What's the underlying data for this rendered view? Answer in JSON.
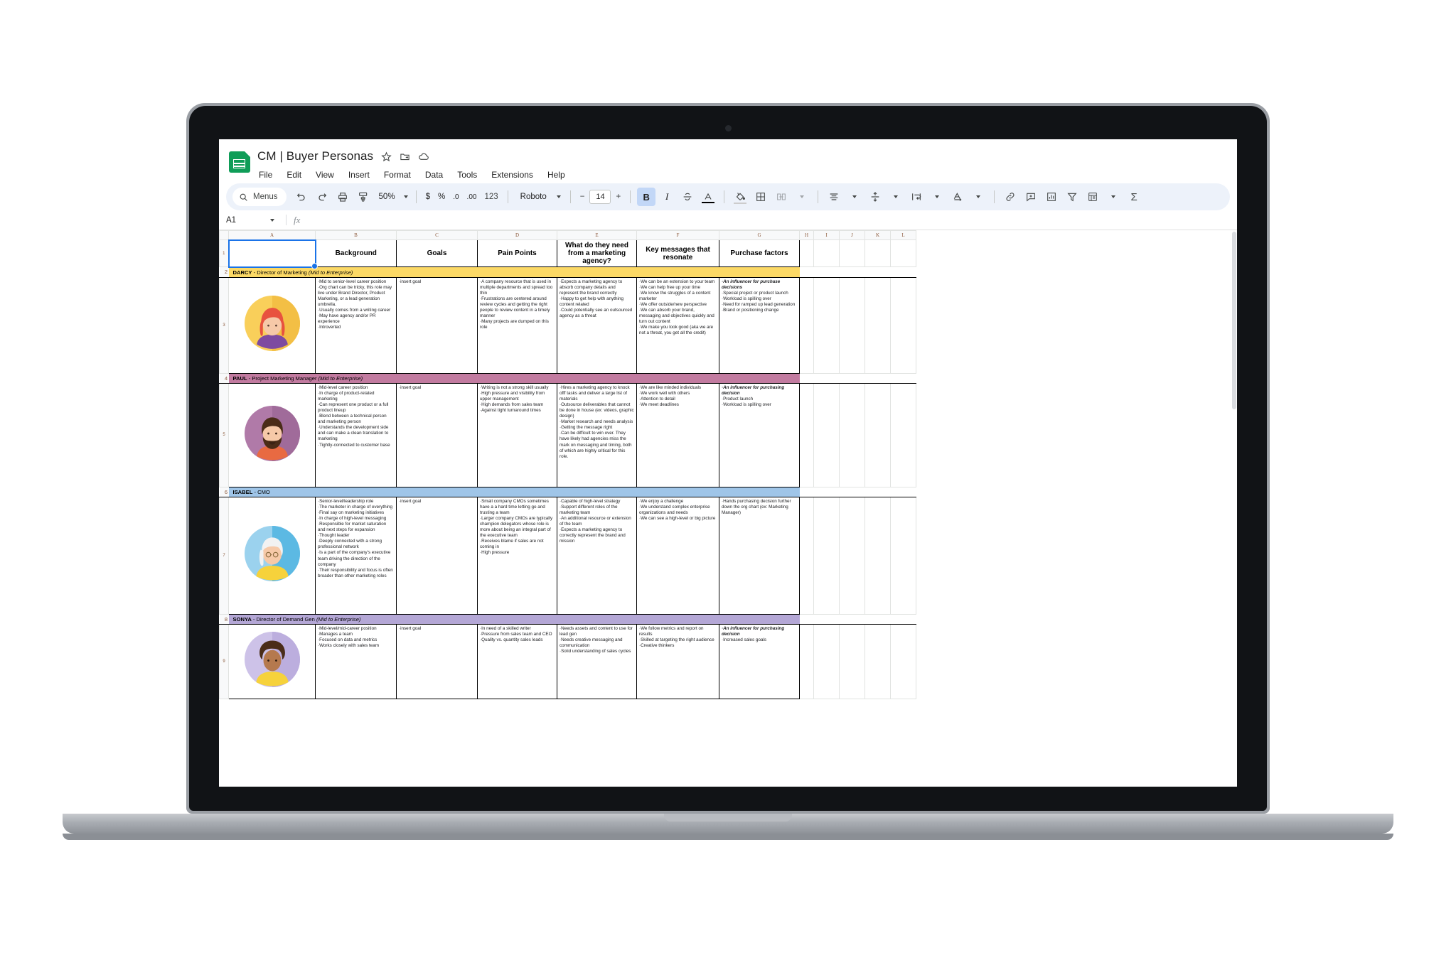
{
  "app": {
    "doc_title": "CM | Buyer Personas",
    "title_icons": [
      "star-icon",
      "move-to-folder-icon",
      "cloud-saved-icon"
    ],
    "menus": [
      "File",
      "Edit",
      "View",
      "Insert",
      "Format",
      "Data",
      "Tools",
      "Extensions",
      "Help"
    ]
  },
  "toolbar": {
    "search_label": "Menus",
    "zoom": "50%",
    "currency": "$",
    "percent": "%",
    "dec_less": ".0",
    "dec_more": ".00",
    "formats": "123",
    "font": "Roboto",
    "font_size": "14",
    "minus": "−",
    "plus": "+",
    "bold": "B",
    "italic": "I",
    "icons": [
      "undo-icon",
      "redo-icon",
      "print-icon",
      "paint-format-icon",
      "strikethrough-icon",
      "text-color-icon",
      "fill-color-icon",
      "borders-icon",
      "merge-cells-icon",
      "horizontal-align-icon",
      "vertical-align-icon",
      "text-wrap-icon",
      "text-rotation-icon",
      "insert-link-icon",
      "insert-comment-icon",
      "insert-chart-icon",
      "filter-icon",
      "functions-icon",
      "sum-icon"
    ]
  },
  "formula_bar": {
    "name_box": "A1",
    "fx_label": "fx",
    "formula_value": ""
  },
  "sheet": {
    "column_letters": [
      "A",
      "B",
      "C",
      "D",
      "E",
      "F",
      "G",
      "H",
      "I",
      "J",
      "K",
      "L"
    ],
    "row_numbers": [
      "1",
      "2",
      "3",
      "4",
      "5",
      "6",
      "7",
      "8",
      "9"
    ],
    "headers": [
      "",
      "Background",
      "Goals",
      "Pain Points",
      "What do they need from a marketing agency?",
      "Key messages that resonate",
      "Purchase factors"
    ],
    "personas": [
      {
        "band_color": "#fcd966",
        "avatar_bg": "#f9cf5a",
        "avatar_type": "darcy",
        "name": "DARCY",
        "role": " - Director of Marketing ",
        "segment": "(Mid to Enterprise)",
        "background": [
          "·Mid to senior-level career position",
          "·Org chart can be tricky, this role may live under Brand Director, Product Marketing, or a lead generation umbrella.",
          "·Usually comes from a writing career",
          "·May have agency and/or PR experience",
          "·Introverted"
        ],
        "goals": [
          "·insert goal"
        ],
        "pain_points": [
          "·A company resource that is used in multiple departments and spread too thin",
          "·Frustrations are centered around review cycles and getting the right people to review content in a timely manner",
          "·Many projects are dumped on this role"
        ],
        "needs": [
          "·Expects a marketing agency to absorb company details and represent the brand correctly",
          "·Happy to get help with anything content related",
          "·Could potentially see an outsourced agency as a threat"
        ],
        "key_messages": [
          "·We can be an extension to your team",
          "·We can help free up your time",
          "·We know the struggles of a content marketer",
          "·We offer outside/new perspective",
          "·We can absorb your brand, messaging and objectives quickly and turn out content",
          "·We make you look good (aka we are not a threat, you get all the credit)"
        ],
        "purchase_factors_lead": "·An influencer for purchase decisions",
        "purchase_factors": [
          "·Special project or product launch",
          "·Workload is spilling over",
          "·Need for ramped up lead generation",
          "·Brand or positioning change"
        ]
      },
      {
        "band_color": "#c27ba0",
        "avatar_bg": "#b07aa8",
        "avatar_type": "paul",
        "name": "PAUL",
        "role": " - Project Marketing Manager ",
        "segment": "(Mid to Enterprise)",
        "background": [
          "·Mid-level career position",
          "·In charge of product-related marketing",
          "·Can represent one product or a full product lineup",
          "·Blend between a technical person and marketing person",
          "·Understands the development side and can make a clean translation to marketing",
          "·Tightly-connected to customer base"
        ],
        "goals": [
          "·insert goal"
        ],
        "pain_points": [
          "·Writing is not a strong skill usually",
          "·High pressure and visibility from upper management",
          "·High demands from sales team",
          "·Against tight turnaround times"
        ],
        "needs": [
          "·Hires a marketing agency to knock offf tasks and deliver a large list of materials",
          "·Outsource deliverables that cannot be done in house (ex: videos, graphic design)",
          "·Market research and needs analysis",
          "·Getting the message right",
          "·Can be difficult to win over. They have likely had agencies miss the mark on messaging and timing, both of which are highly critical for this role."
        ],
        "key_messages": [
          "·We are like minded individuals",
          "·We work well with others",
          "·Attention to detail",
          "·We meet deadlines"
        ],
        "purchase_factors_lead": "·An influencer for purchasing decision",
        "purchase_factors": [
          "·Product launch",
          "·Workload is spilling over"
        ]
      },
      {
        "band_color": "#9fc5e8",
        "avatar_bg": "#9bd2ee",
        "avatar_type": "isabel",
        "name": "ISABEL",
        "role": " - CMO",
        "segment": "",
        "background": [
          "·Senior-level/leadership role",
          "·The marketer in charge of everything",
          "·Final say on marketing initiatives",
          "·In charge of high-level messaging",
          "·Responsible for market saturation and next steps for expansion",
          "·Thought leader",
          "·Deeply connected with a strong professional network",
          "·Is a part of the company's executive team driving the direction of the company",
          "·Their responsibility and focus is often broader than other marketing roles"
        ],
        "goals": [
          "·insert goal"
        ],
        "pain_points": [
          "·Small company CMOs sometimes have a a hard time letting go and trusting a team",
          "·Larger company CMOs are typically champion delegators whose role is more about being an integral part of the executive team",
          "·Receives blame if sales are not coming in",
          "·High pressure"
        ],
        "needs": [
          "·Capable of high-level strategy",
          "·Support different roles of the marketing team",
          "·An additional resource or extension of the team",
          "·Expects a marketing agency to correctly represent the brand and mission"
        ],
        "key_messages": [
          "·We enjoy a challenge",
          "·We understand complex enterprise organizations and needs",
          "·We can see a high-level or big picture"
        ],
        "purchase_factors_lead": "",
        "purchase_factors": [
          "·Hands purchasing decision further down the org chart (ex: Marketing Manager)"
        ]
      },
      {
        "band_color": "#b4a7d6",
        "avatar_bg": "#cdc2e8",
        "avatar_type": "sonya",
        "name": "SONYA",
        "role": " - Director of Demand Gen ",
        "segment": "(Mid to Enterprise)",
        "background": [
          "·Mid-level/mid-career position",
          "·Manages a team",
          "·Focused on data and metrics",
          "·Works closely with sales team"
        ],
        "goals": [
          "·insert goal"
        ],
        "pain_points": [
          "·In need of a skilled writer",
          "·Pressure from sales team and CEO",
          "·Quality vs. quantity sales leads"
        ],
        "needs": [
          "·Needs assets and content to use for lead gen",
          "·Needs creative messaging and communication",
          "·Solid understanding of sales cycles"
        ],
        "key_messages": [
          "·We follow metrics and report on results",
          "·Skilled at targeting the right audience",
          "·Creative thinkers"
        ],
        "purchase_factors_lead": "·An influencer for purchasing decision",
        "purchase_factors": [
          "·Increased sales goals"
        ]
      }
    ]
  },
  "colors": {
    "accent": "#1a73e8",
    "toolbar_bg": "#edf2fa",
    "sheets_green": "#0f9d58"
  }
}
